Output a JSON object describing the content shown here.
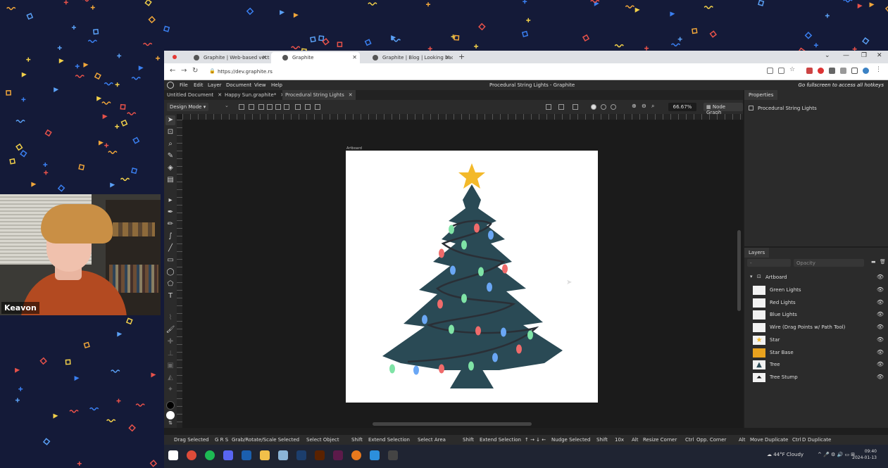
{
  "webcam": {
    "name": "Keavon"
  },
  "browser": {
    "tabs": [
      {
        "label": "Graphite | Web-based vector gr",
        "active": false
      },
      {
        "label": "Graphite",
        "active": true
      },
      {
        "label": "Graphite | Blog | Looking back",
        "active": false
      }
    ],
    "url": "https://dev.graphite.rs"
  },
  "app": {
    "menus": [
      "File",
      "Edit",
      "Layer",
      "Document",
      "View",
      "Help"
    ],
    "title": "Procedural String Lights - Graphite",
    "fullscreen_hint": "Go fullscreen to access all hotkeys",
    "doc_tabs": [
      {
        "label": "Untitled Document",
        "active": false
      },
      {
        "label": "Happy Sun.graphite*",
        "active": false
      },
      {
        "label": "Procedural String Lights",
        "active": true
      }
    ],
    "mode": "Design Mode",
    "zoom": "66.67%",
    "node_graph_label": "Node Graph",
    "artboard_label": "Artboard",
    "properties": {
      "title": "Properties",
      "selected": "Procedural String Lights"
    },
    "layers": {
      "title": "Layers",
      "blend": "-",
      "opacity_placeholder": "Opacity",
      "root": "Artboard",
      "items": [
        {
          "name": "Green Lights",
          "thumb": "blank"
        },
        {
          "name": "Red Lights",
          "thumb": "blank"
        },
        {
          "name": "Blue Lights",
          "thumb": "blank"
        },
        {
          "name": "Wire (Drag Points w/ Path Tool)",
          "thumb": "blank"
        },
        {
          "name": "Star",
          "thumb": "star"
        },
        {
          "name": "Star Base",
          "thumb": "orange"
        },
        {
          "name": "Tree",
          "thumb": "tree"
        },
        {
          "name": "Tree Stump",
          "thumb": "stump"
        }
      ]
    },
    "status_hints": [
      "Drag Selected",
      "G R S",
      "Grab/Rotate/Scale Selected",
      "Select Object",
      "Shift",
      "Extend Selection",
      "Select Area",
      "Shift",
      "Extend Selection",
      "↑ → ↓ ←",
      "Nudge Selected",
      "Shift",
      "10x",
      "Alt",
      "Resize Corner",
      "Ctrl",
      "Opp. Corner",
      "Alt",
      "Move Duplicate",
      "Ctrl",
      "D",
      "Duplicate"
    ]
  },
  "taskbar": {
    "weather": "44°F  Cloudy",
    "time": "09:40",
    "date": "2024-01-13"
  },
  "colors": {
    "tree": "#2a4a55",
    "star": "#f3b92a",
    "light_green": "#7fe3a6",
    "light_red": "#f06b6b",
    "light_blue": "#6aa7f5"
  }
}
